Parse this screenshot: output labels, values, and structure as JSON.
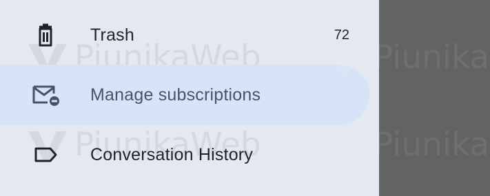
{
  "drawer": {
    "items": [
      {
        "icon": "trash-icon",
        "label": "Trash",
        "count": "72",
        "selected": false
      },
      {
        "icon": "manage-subscriptions-icon",
        "label": "Manage subscriptions",
        "selected": true
      },
      {
        "icon": "label-icon",
        "label": "Conversation History",
        "selected": false
      }
    ]
  },
  "watermark": {
    "text": "PiunikaWeb"
  },
  "colors": {
    "drawer_bg": "#e4e8f0",
    "selected_bg": "#d7e3f6",
    "scrim": "#626365",
    "text": "#1f2328",
    "selected_text": "#44546c"
  }
}
